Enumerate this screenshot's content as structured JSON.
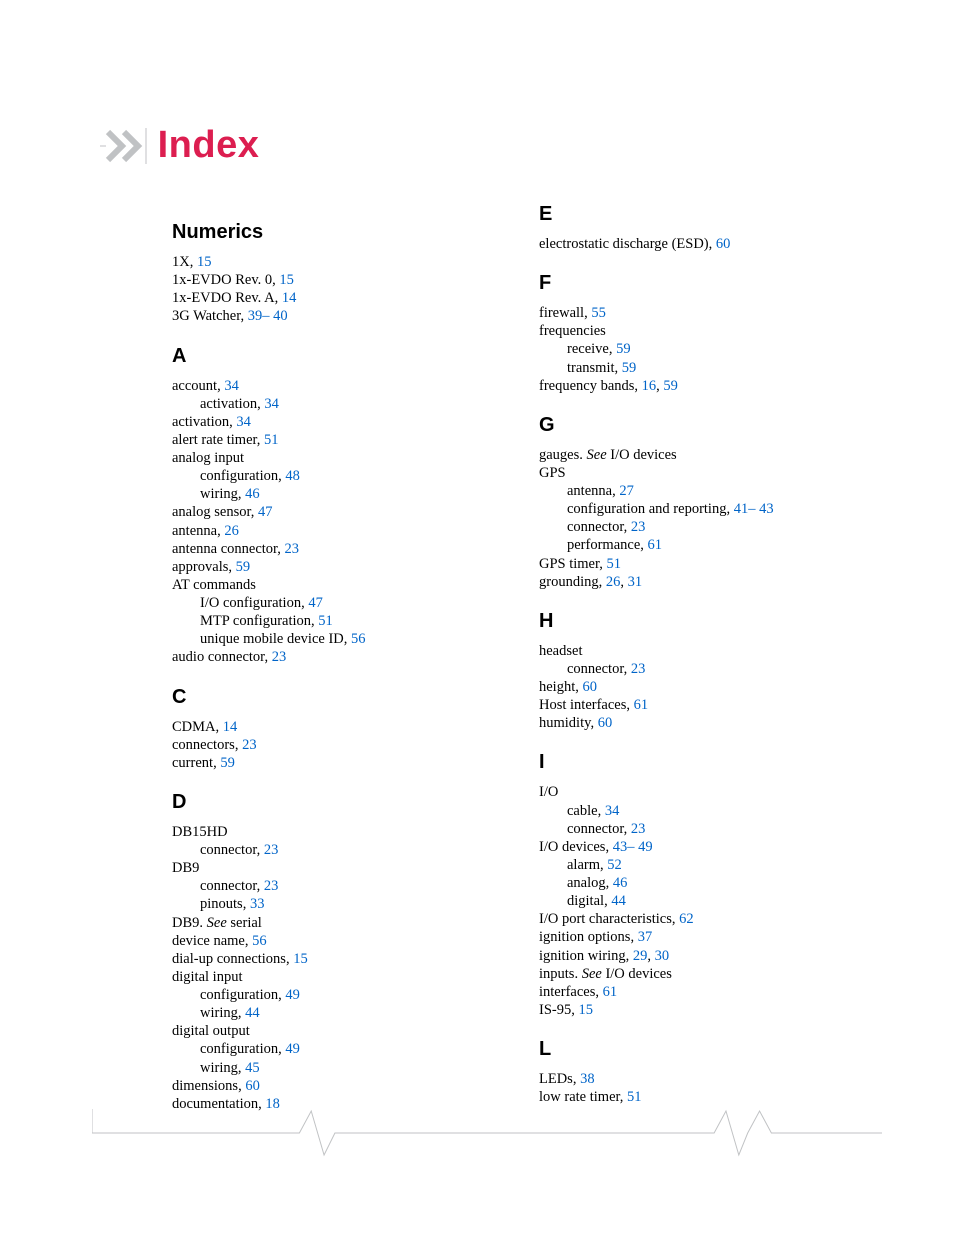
{
  "header": {
    "title": "Index"
  },
  "sections": [
    {
      "letter": "Numerics",
      "entries": [
        {
          "level": 0,
          "term": "1X",
          "pages": [
            "15"
          ]
        },
        {
          "level": 0,
          "term": "1x-EVDO Rev. 0",
          "pages": [
            "15"
          ]
        },
        {
          "level": 0,
          "term": "1x-EVDO Rev. A",
          "pages": [
            "14"
          ]
        },
        {
          "level": 0,
          "term": "3G Watcher",
          "pages": [
            "39– 40"
          ]
        }
      ]
    },
    {
      "letter": "A",
      "entries": [
        {
          "level": 0,
          "term": "account",
          "pages": [
            "34"
          ]
        },
        {
          "level": 1,
          "term": "activation",
          "pages": [
            "34"
          ]
        },
        {
          "level": 0,
          "term": "activation",
          "pages": [
            "34"
          ]
        },
        {
          "level": 0,
          "term": "alert rate timer",
          "pages": [
            "51"
          ]
        },
        {
          "level": 0,
          "term": "analog input",
          "pages": []
        },
        {
          "level": 1,
          "term": "configuration",
          "pages": [
            "48"
          ]
        },
        {
          "level": 1,
          "term": "wiring",
          "pages": [
            "46"
          ]
        },
        {
          "level": 0,
          "term": "analog sensor",
          "pages": [
            "47"
          ]
        },
        {
          "level": 0,
          "term": "antenna",
          "pages": [
            "26"
          ]
        },
        {
          "level": 0,
          "term": "antenna connector",
          "pages": [
            "23"
          ]
        },
        {
          "level": 0,
          "term": "approvals",
          "pages": [
            "59"
          ]
        },
        {
          "level": 0,
          "term": "AT commands",
          "pages": []
        },
        {
          "level": 1,
          "term": "I/O configuration",
          "pages": [
            "47"
          ]
        },
        {
          "level": 1,
          "term": "MTP configuration",
          "pages": [
            "51"
          ]
        },
        {
          "level": 1,
          "term": "unique mobile device ID",
          "pages": [
            "56"
          ]
        },
        {
          "level": 0,
          "term": "audio connector",
          "pages": [
            "23"
          ]
        }
      ]
    },
    {
      "letter": "C",
      "entries": [
        {
          "level": 0,
          "term": "CDMA",
          "pages": [
            "14"
          ]
        },
        {
          "level": 0,
          "term": "connectors",
          "pages": [
            "23"
          ]
        },
        {
          "level": 0,
          "term": "current",
          "pages": [
            "59"
          ]
        }
      ]
    },
    {
      "letter": "D",
      "entries": [
        {
          "level": 0,
          "term": "DB15HD",
          "pages": []
        },
        {
          "level": 1,
          "term": "connector",
          "pages": [
            "23"
          ]
        },
        {
          "level": 0,
          "term": "DB9",
          "pages": []
        },
        {
          "level": 1,
          "term": "connector",
          "pages": [
            "23"
          ]
        },
        {
          "level": 1,
          "term": "pinouts",
          "pages": [
            "33"
          ]
        },
        {
          "level": 0,
          "term": "DB9",
          "see": "serial"
        },
        {
          "level": 0,
          "term": "device name",
          "pages": [
            "56"
          ]
        },
        {
          "level": 0,
          "term": "dial-up connections",
          "pages": [
            "15"
          ]
        },
        {
          "level": 0,
          "term": "digital input",
          "pages": []
        },
        {
          "level": 1,
          "term": "configuration",
          "pages": [
            "49"
          ]
        },
        {
          "level": 1,
          "term": "wiring",
          "pages": [
            "44"
          ]
        },
        {
          "level": 0,
          "term": "digital output",
          "pages": []
        },
        {
          "level": 1,
          "term": "configuration",
          "pages": [
            "49"
          ]
        },
        {
          "level": 1,
          "term": "wiring",
          "pages": [
            "45"
          ]
        },
        {
          "level": 0,
          "term": "dimensions",
          "pages": [
            "60"
          ]
        },
        {
          "level": 0,
          "term": "documentation",
          "pages": [
            "18"
          ]
        }
      ]
    },
    {
      "letter": "E",
      "entries": [
        {
          "level": 0,
          "term": "electrostatic discharge (ESD)",
          "pages": [
            "60"
          ]
        }
      ]
    },
    {
      "letter": "F",
      "entries": [
        {
          "level": 0,
          "term": "firewall",
          "pages": [
            "55"
          ]
        },
        {
          "level": 0,
          "term": "frequencies",
          "pages": []
        },
        {
          "level": 1,
          "term": "receive",
          "pages": [
            "59"
          ]
        },
        {
          "level": 1,
          "term": "transmit",
          "pages": [
            "59"
          ]
        },
        {
          "level": 0,
          "term": "frequency bands",
          "pages": [
            "16",
            "59"
          ]
        }
      ]
    },
    {
      "letter": "G",
      "entries": [
        {
          "level": 0,
          "term": "gauges",
          "see": "I/O devices"
        },
        {
          "level": 0,
          "term": "GPS",
          "pages": []
        },
        {
          "level": 1,
          "term": "antenna",
          "pages": [
            "27"
          ]
        },
        {
          "level": 1,
          "term": "configuration and reporting",
          "pages": [
            "41– 43"
          ]
        },
        {
          "level": 1,
          "term": "connector",
          "pages": [
            "23"
          ]
        },
        {
          "level": 1,
          "term": "performance",
          "pages": [
            "61"
          ]
        },
        {
          "level": 0,
          "term": "GPS timer",
          "pages": [
            "51"
          ]
        },
        {
          "level": 0,
          "term": "grounding",
          "pages": [
            "26",
            "31"
          ]
        }
      ]
    },
    {
      "letter": "H",
      "entries": [
        {
          "level": 0,
          "term": "headset",
          "pages": []
        },
        {
          "level": 1,
          "term": "connector",
          "pages": [
            "23"
          ]
        },
        {
          "level": 0,
          "term": "height",
          "pages": [
            "60"
          ]
        },
        {
          "level": 0,
          "term": "Host interfaces",
          "pages": [
            "61"
          ]
        },
        {
          "level": 0,
          "term": "humidity",
          "pages": [
            "60"
          ]
        }
      ]
    },
    {
      "letter": "I",
      "entries": [
        {
          "level": 0,
          "term": "I/O",
          "pages": []
        },
        {
          "level": 1,
          "term": "cable",
          "pages": [
            "34"
          ]
        },
        {
          "level": 1,
          "term": "connector",
          "pages": [
            "23"
          ]
        },
        {
          "level": 0,
          "term": "I/O devices",
          "pages": [
            "43– 49"
          ]
        },
        {
          "level": 1,
          "term": "alarm",
          "pages": [
            "52"
          ]
        },
        {
          "level": 1,
          "term": "analog",
          "pages": [
            "46"
          ]
        },
        {
          "level": 1,
          "term": "digital",
          "pages": [
            "44"
          ]
        },
        {
          "level": 0,
          "term": "I/O port characteristics",
          "pages": [
            "62"
          ]
        },
        {
          "level": 0,
          "term": "ignition options",
          "pages": [
            "37"
          ]
        },
        {
          "level": 0,
          "term": "ignition wiring",
          "pages": [
            "29",
            "30"
          ]
        },
        {
          "level": 0,
          "term": "inputs",
          "see": "I/O devices"
        },
        {
          "level": 0,
          "term": "interfaces",
          "pages": [
            "61"
          ]
        },
        {
          "level": 0,
          "term": "IS-95",
          "pages": [
            "15"
          ]
        }
      ]
    },
    {
      "letter": "L",
      "entries": [
        {
          "level": 0,
          "term": "LEDs",
          "pages": [
            "38"
          ]
        },
        {
          "level": 0,
          "term": "low rate timer",
          "pages": [
            "51"
          ]
        }
      ]
    }
  ]
}
